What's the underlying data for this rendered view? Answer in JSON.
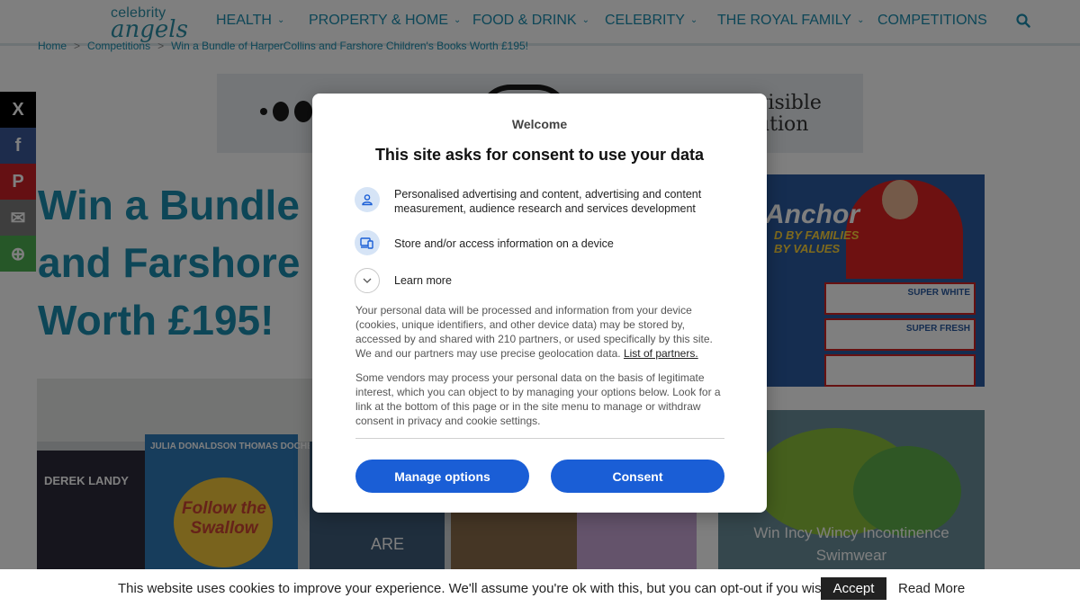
{
  "site": {
    "logo_line1": "celebrity",
    "logo_line2": "angels",
    "nav": [
      {
        "label": "HEALTH"
      },
      {
        "label": "PROPERTY & HOME"
      },
      {
        "label": "FOOD & DRINK"
      },
      {
        "label": "CELEBRITY"
      },
      {
        "label": "THE ROYAL FAMILY"
      },
      {
        "label": "COMPETITIONS"
      }
    ],
    "search_icon": "search-icon",
    "breadcrumb": [
      "Home",
      "Competitions",
      "Win a Bundle of HarperCollins and Farshore Children's Books Worth £195!"
    ],
    "breadcrumb_sep": ">",
    "banner_text": [
      "visible",
      "ution"
    ],
    "headline_lines": [
      "Win a Bundle",
      "and Farshore",
      "Worth £195!"
    ],
    "share_buttons": [
      {
        "icon": "x-icon",
        "color": "#000000",
        "glyph": "X"
      },
      {
        "icon": "facebook-icon",
        "color": "#3b5998",
        "glyph": "f"
      },
      {
        "icon": "pinterest-icon",
        "color": "#cb2027",
        "glyph": "P"
      },
      {
        "icon": "email-icon",
        "color": "#7d7d7d",
        "glyph": "✉"
      },
      {
        "icon": "more-options-icon",
        "color": "#4caf50",
        "glyph": "⊕"
      }
    ],
    "hero_books": [
      "DEREK LANDY",
      "JULIA DONALDSON",
      "THOMAS DOCHERTY",
      "Follow the Swallow",
      "ARE"
    ],
    "ad": {
      "brand": "Anchor",
      "tagline_line1": "D BY FAMILIES",
      "tagline_line2": "BY VALUES",
      "packs": [
        "SUPER WHITE",
        "SUPER FRESH",
        ""
      ]
    },
    "side_caption": "Win Incy Wincy Incontinence Swimwear"
  },
  "consent": {
    "welcome": "Welcome",
    "title": "This site asks for consent to use your data",
    "purposes": [
      {
        "icon": "person-icon",
        "text": "Personalised advertising and content, advertising and content measurement, audience research and services development"
      },
      {
        "icon": "devices-icon",
        "text": "Store and/or access information on a device"
      }
    ],
    "learn_more": "Learn more",
    "paragraph1": "Your personal data will be processed and information from your device (cookies, unique identifiers, and other device data) may be stored by, accessed by and shared with 210 partners, or used specifically by this site. We and our partners may use precise geolocation data.",
    "partners_link": "List of partners.",
    "paragraph2": "Some vendors may process your personal data on the basis of legitimate interest, which you can object to by managing your options below. Look for a link at the bottom of this page or in the site menu to manage or withdraw consent in privacy and cookie settings.",
    "manage_button": "Manage options",
    "consent_button": "Consent",
    "accent": "#1a5ed6"
  },
  "cookie_bar": {
    "text": "This website uses cookies to improve your experience. We'll assume you're ok with this, but you can opt-out if you wish.",
    "accept": "Accept",
    "read_more": "Read More"
  }
}
